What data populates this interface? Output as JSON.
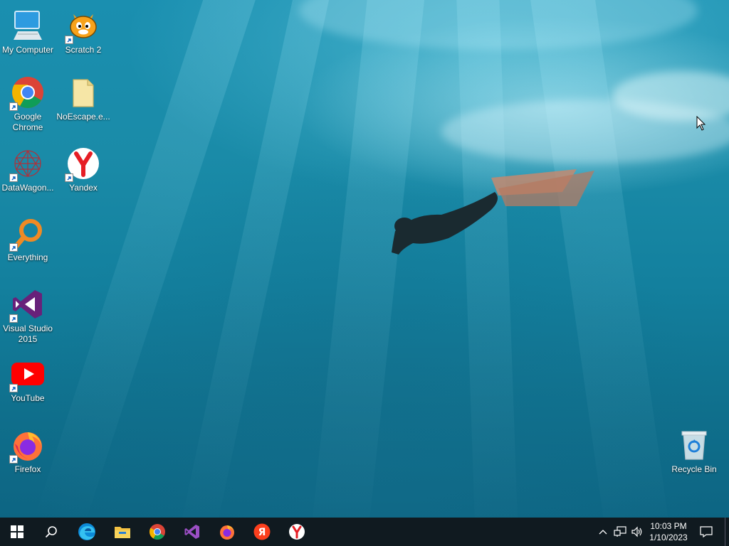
{
  "desktop_icons": [
    {
      "label": "My Computer",
      "icon": "monitor-icon",
      "shortcut": false
    },
    {
      "label": "Scratch 2",
      "icon": "scratch-cat-icon",
      "shortcut": true
    },
    {
      "label": "Google Chrome",
      "icon": "chrome-icon",
      "shortcut": true
    },
    {
      "label": "NoEscape.e...",
      "icon": "file-icon",
      "shortcut": false
    },
    {
      "label": "DataWagon...",
      "icon": "datawagon-icon",
      "shortcut": true
    },
    {
      "label": "Yandex",
      "icon": "yandex-icon",
      "shortcut": true
    },
    {
      "label": "Everything",
      "icon": "everything-search-icon",
      "shortcut": true
    },
    {
      "label": "Visual Studio 2015",
      "icon": "visual-studio-icon",
      "shortcut": true
    },
    {
      "label": "YouTube",
      "icon": "youtube-icon",
      "shortcut": true
    },
    {
      "label": "Firefox",
      "icon": "firefox-icon",
      "shortcut": true
    },
    {
      "label": "Recycle Bin",
      "icon": "recycle-bin-icon",
      "shortcut": false
    }
  ],
  "taskbar": {
    "pinned": [
      "start-icon",
      "search-icon",
      "edge-icon",
      "file-explorer-icon",
      "chrome-icon",
      "visual-studio-icon",
      "firefox-icon",
      "yandex-browser-icon",
      "yandex-icon"
    ],
    "tray_icons": [
      "chevron-up-icon",
      "network-icon",
      "volume-icon"
    ],
    "clock": {
      "time": "10:03 PM",
      "date": "1/10/2023"
    },
    "notification_icon": "notification-icon"
  },
  "colors": {
    "taskbar": "#101a20",
    "water": "#1a8ba8"
  }
}
